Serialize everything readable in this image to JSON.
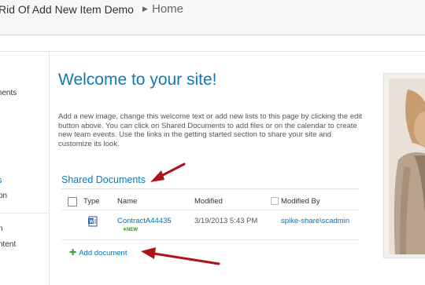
{
  "header": {
    "site_title": "Rid Of Add New Item Demo",
    "breadcrumb_current": "Home"
  },
  "leftnav": {
    "items": [
      "ments",
      "s",
      "on",
      "n",
      "ntent"
    ]
  },
  "main": {
    "title": "Welcome to your site!",
    "intro": "Add a new image, change this welcome text or add new lists to this page by clicking the edit button above. You can click on Shared Documents to add files or on the calendar to create new team events. Use the links in the getting started section to share your site and customize its look."
  },
  "documents": {
    "title": "Shared Documents",
    "columns": {
      "type": "Type",
      "name": "Name",
      "modified": "Modified",
      "modified_by": "Modified By"
    },
    "rows": [
      {
        "name": "ContractA44435",
        "modified": "3/19/2013 5:43 PM",
        "modified_by": "spike-share\\scadmin",
        "badge": "NEW"
      }
    ],
    "add_label": "Add document"
  },
  "colors": {
    "accent": "#0e7ab6",
    "link": "#0072bc",
    "arrow": "#b0121a",
    "new_badge": "#3a8a2a"
  }
}
